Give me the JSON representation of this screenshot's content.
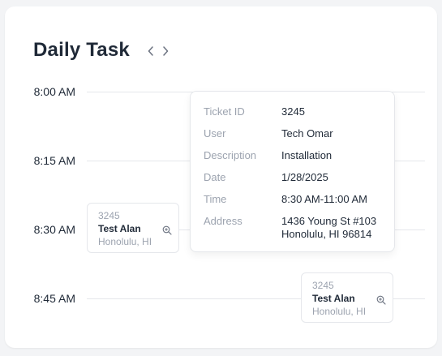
{
  "header": {
    "title": "Daily Task"
  },
  "icons": {
    "prev": "chevron-left-icon",
    "next": "chevron-right-icon",
    "zoom": "zoom-in-icon"
  },
  "colors": {
    "text": "#1f2937",
    "muted": "#9ca3af",
    "border": "#e5e7eb",
    "background": "#f3f4f6"
  },
  "times": [
    "8:00 AM",
    "8:15 AM",
    "8:30 AM",
    "8:45 AM"
  ],
  "events": [
    {
      "id": "3245",
      "user": "Test Alan",
      "location": "Honolulu, HI"
    },
    {
      "id": "3245",
      "user": "Test Alan",
      "location": "Honolulu, HI"
    }
  ],
  "tooltip": {
    "ticket_id_label": "Ticket ID",
    "ticket_id": "3245",
    "user_label": "User",
    "user": "Tech Omar",
    "description_label": "Description",
    "description": "Installation",
    "date_label": "Date",
    "date": "1/28/2025",
    "time_label": "Time",
    "time": "8:30 AM-11:00 AM",
    "address_label": "Address",
    "address_line1": "1436 Young St #103",
    "address_line2": "Honolulu, HI 96814"
  }
}
